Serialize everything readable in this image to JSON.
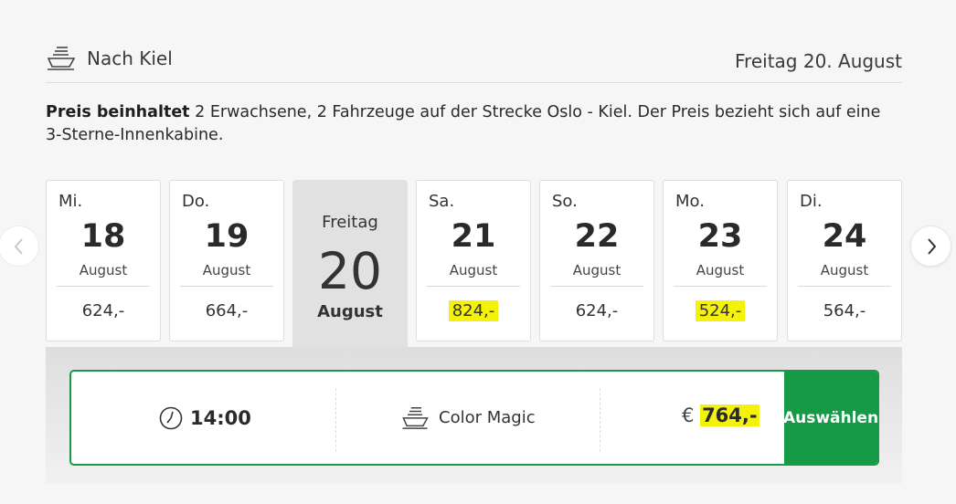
{
  "header": {
    "destination": "Nach Kiel",
    "date": "Freitag 20. August"
  },
  "note": {
    "bold": "Preis beinhaltet",
    "text": " 2 Erwachsene, 2 Fahrzeuge auf der Strecke Oslo - Kiel. Der Preis bezieht sich auf eine 3-Sterne-Innenkabine."
  },
  "days": [
    {
      "dow": "Mi.",
      "day": "18",
      "month": "August",
      "price": "624,-"
    },
    {
      "dow": "Do.",
      "day": "19",
      "month": "August",
      "price": "664,-"
    },
    {
      "dow": "Freitag",
      "day": "20",
      "month": "August"
    },
    {
      "dow": "Sa.",
      "day": "21",
      "month": "August",
      "price": "824,-"
    },
    {
      "dow": "So.",
      "day": "22",
      "month": "August",
      "price": "624,-"
    },
    {
      "dow": "Mo.",
      "day": "23",
      "month": "August",
      "price": "524,-"
    },
    {
      "dow": "Di.",
      "day": "24",
      "month": "August",
      "price": "564,-"
    }
  ],
  "sailing": {
    "time": "14:00",
    "ship": "Color Magic",
    "currency": "€",
    "price": "764,-",
    "select_label": "Auswählen"
  },
  "colors": {
    "accent_green": "#169a46",
    "highlight": "#f4f10a"
  },
  "icons": {
    "header": "ship-icon",
    "time": "clock-icon",
    "ship": "ship-icon",
    "prev": "chevron-left-icon",
    "next": "chevron-right-icon"
  }
}
